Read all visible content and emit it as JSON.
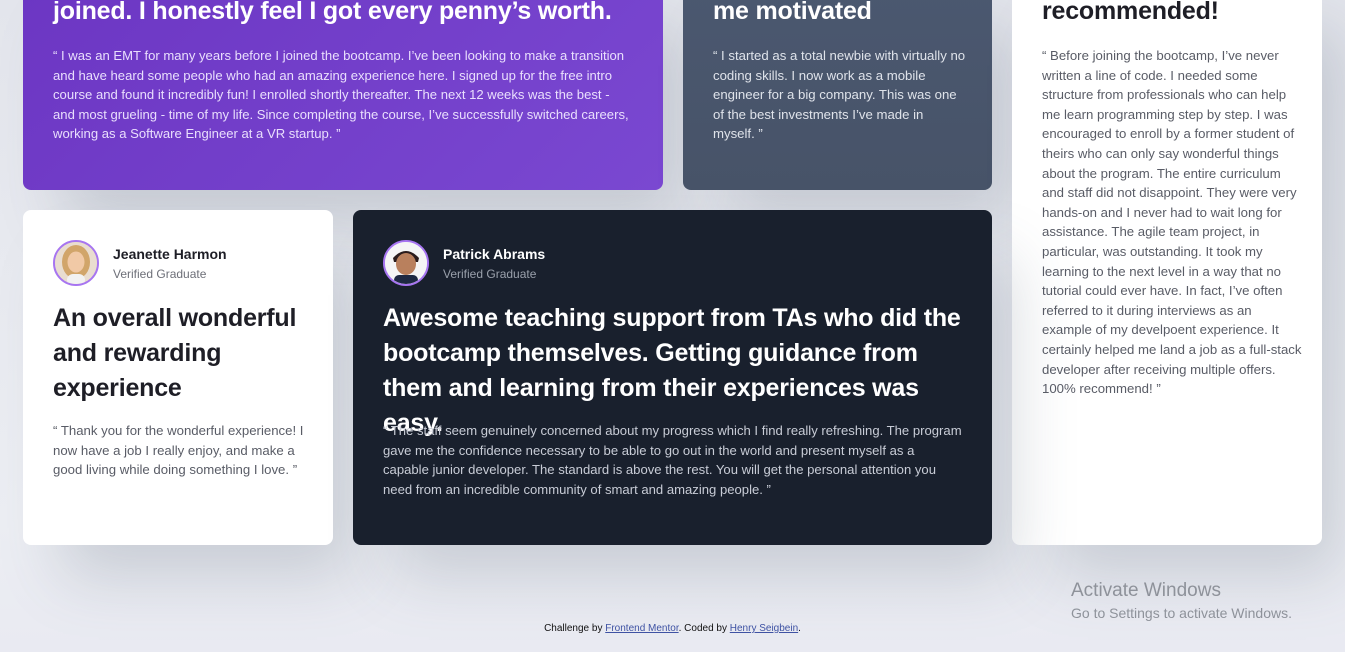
{
  "testimonials": [
    {
      "headline": "joined. I honestly feel I got every penny’s worth.",
      "quote": "“ I was an EMT for many years before I joined the bootcamp. I’ve been looking to make a transition and have heard some people who had an amazing experience here. I signed up for the free intro course and found it incredibly fun! I enrolled shortly thereafter. The next 12 weeks was the best - and most grueling - time of my life. Since completing the course, I’ve successfully switched careers, working as a Software Engineer at a VR startup. ”"
    },
    {
      "headline": "me motivated",
      "quote": "“ I started as a total newbie with virtually no coding skills. I now work as a mobile engineer for a big company. This was one of the best investments I’ve made in myself. ”"
    },
    {
      "headline": "recommended!",
      "quote": "“ Before joining the bootcamp, I’ve never written a line of code. I needed some structure from professionals who can help me learn programming step by step. I was encouraged to enroll by a former student of theirs who can only say wonderful things about the program. The entire curriculum and staff did not disappoint. They were very hands-on and I never had to wait long for assistance. The agile team project, in particular, was outstanding. It took my learning to the next level in a way that no tutorial could ever have. In fact, I’ve often referred to it during interviews as an example of my develpoent experience. It certainly helped me land a job as a full-stack developer after receiving multiple offers. 100% recommend! ”"
    },
    {
      "name": "Jeanette Harmon",
      "status": "Verified Graduate",
      "headline": "An overall wonderful and rewarding experience",
      "quote": "“ Thank you for the wonderful experience! I now have a job I really enjoy, and make a good living while doing something I love. ”"
    },
    {
      "name": "Patrick Abrams",
      "status": "Verified Graduate",
      "headline": "Awesome teaching support from TAs who did the bootcamp themselves. Getting guidance from them and learning from their experiences was easy.",
      "quote": "“ The staff seem genuinely concerned about my progress which I find really refreshing. The program gave me the confidence necessary to be able to go out in the world and present myself as a capable junior developer. The standard is above the rest. You will get the personal attention you need from an incredible community of smart and amazing people. ”"
    }
  ],
  "footer": {
    "prefix": "Challenge by",
    "link1": "Frontend Mentor",
    "middle": ". Coded by",
    "link2": "Henry Seigbein",
    "suffix": "."
  },
  "watermark": {
    "title": "Activate Windows",
    "subtitle": "Go to Settings to activate Windows."
  },
  "colors": {
    "purple": "#733fc8",
    "gray_blue": "#48556a",
    "dark": "#19202d",
    "white": "#ffffff",
    "avatar_border_purple": "#a775f1"
  }
}
